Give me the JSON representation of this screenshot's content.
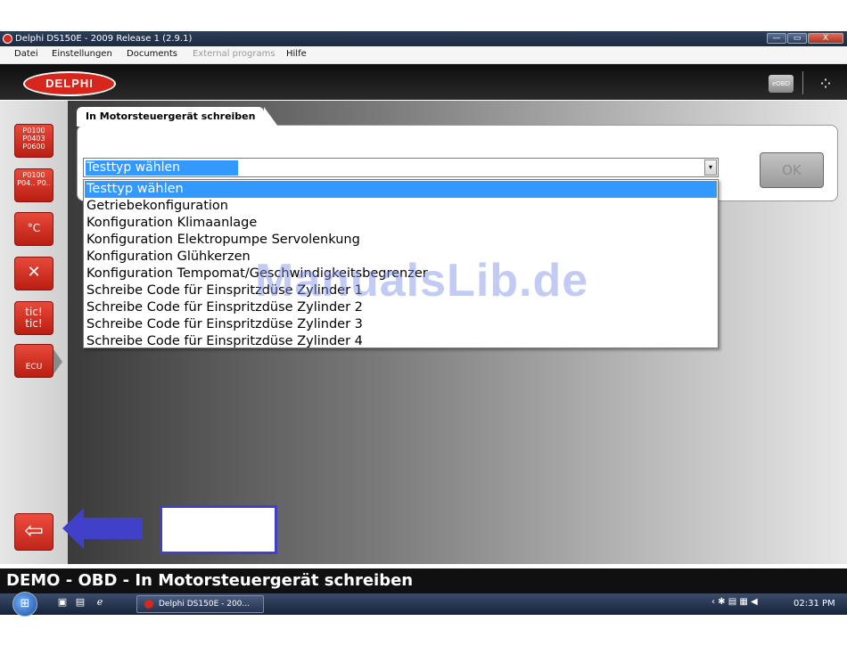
{
  "window": {
    "title": "Delphi DS150E - 2009 Release 1 (2.9.1)",
    "min_label": "—",
    "max_label": "▭",
    "close_label": "X"
  },
  "menu": [
    {
      "label": "Datei",
      "enabled": true
    },
    {
      "label": "Einstellungen",
      "enabled": true
    },
    {
      "label": "Documents",
      "enabled": true
    },
    {
      "label": "External programs",
      "enabled": false
    },
    {
      "label": "Hilfe",
      "enabled": true
    }
  ],
  "header": {
    "logo_text": "DELPHI",
    "eobd_label": "eOBD",
    "gear_icon": "⁘"
  },
  "sidebar": {
    "buttons": [
      {
        "name": "dtc-codes-button",
        "icon": "dtc-codes-icon",
        "text": "P0100 P0403 P0600"
      },
      {
        "name": "dtc-erase-button",
        "icon": "dtc-erase-icon",
        "text": "P0100 P04.. P0.."
      },
      {
        "name": "live-data-button",
        "icon": "live-data-icon",
        "text": "°C"
      },
      {
        "name": "service-button",
        "icon": "tools-icon",
        "text": "✕"
      },
      {
        "name": "activation-button",
        "icon": "tic-icon",
        "text": "tic! tic!"
      },
      {
        "name": "ecu-program-button",
        "icon": "ecu-icon",
        "text": "ECU"
      }
    ]
  },
  "panel": {
    "tab_label": "In Motorsteuergerät schreiben",
    "select": {
      "value": "Testtyp wählen",
      "arrow": "▾"
    },
    "ok_label": "OK",
    "options": [
      "Testtyp wählen",
      "Getriebekonfiguration",
      "Konfiguration Klimaanlage",
      "Konfiguration Elektropumpe Servolenkung",
      "Konfiguration Glühkerzen",
      "Konfiguration Tempomat/Geschwindigkeitsbegrenzer",
      "Schreibe Code für Einspritzdüse Zylinder 1",
      "Schreibe Code für Einspritzdüse Zylinder 2",
      "Schreibe Code für Einspritzdüse Zylinder 3",
      "Schreibe Code für Einspritzdüse Zylinder 4"
    ],
    "selected_index": 0
  },
  "watermark": "ManualsLib.de",
  "back_label": "⇦",
  "status": "DEMO - OBD - In Motorsteuergerät schreiben",
  "taskbar": {
    "task_label": "Delphi DS150E - 200...",
    "clock": "02:31 PM",
    "tray_icons": "‹ ✱ ▤ ▦ ◀"
  },
  "colors": {
    "delphi_red": "#d7261c",
    "selection_blue": "#3399ff",
    "annotation_blue": "#4040c8"
  }
}
